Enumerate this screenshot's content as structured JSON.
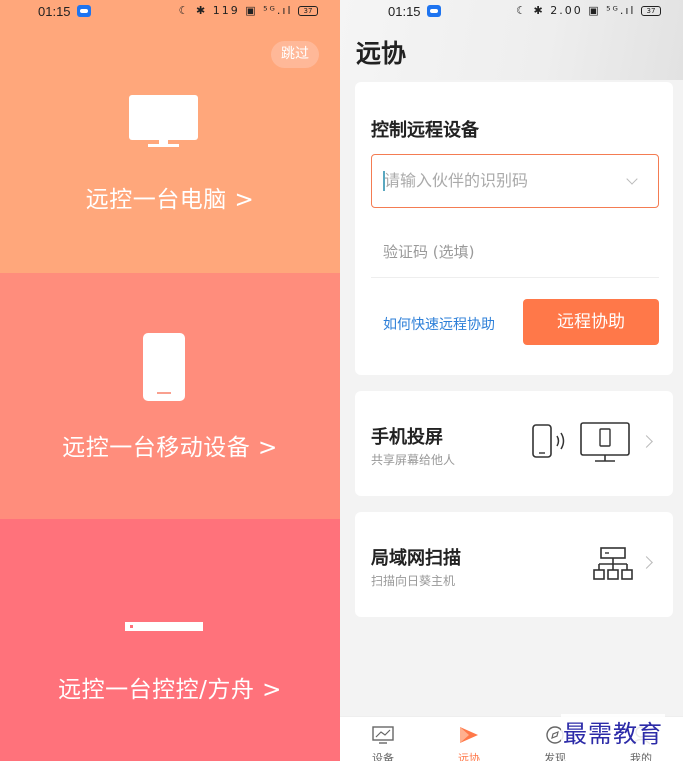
{
  "left": {
    "status": {
      "time": "01:15",
      "icons": "☾ ✱ 119 ▣ ⁵ᴳ.ıl",
      "battery": "37"
    },
    "skip_label": "跳过",
    "options": [
      {
        "label": "远控一台电脑 >",
        "icon": "monitor-icon"
      },
      {
        "label": "远控一台移动设备 >",
        "icon": "phone-icon"
      },
      {
        "label": "远控一台控控/方舟 >",
        "icon": "box-device-icon"
      }
    ],
    "colors": {
      "panel1": "#FFA77B",
      "panel2": "#FF8D7C",
      "panel3": "#FF727B"
    }
  },
  "right": {
    "status": {
      "time": "01:15",
      "icons": "☾ ✱ 2.00 ▣ ⁵ᴳ.ıl",
      "battery": "37"
    },
    "title": "远协",
    "control": {
      "title": "控制远程设备",
      "partner_placeholder": "请输入伙伴的识别码",
      "verify_placeholder": "验证码 (选填)",
      "help_link": "如何快速远程协助",
      "assist_button": "远程协助"
    },
    "features": [
      {
        "title": "手机投屏",
        "subtitle": "共享屏幕给他人",
        "icon": "cast-screen-icon"
      },
      {
        "title": "局域网扫描",
        "subtitle": "扫描向日葵主机",
        "icon": "network-scan-icon"
      }
    ],
    "tabs": [
      {
        "label": "设备",
        "icon": "device-icon",
        "active": false
      },
      {
        "label": "远协",
        "icon": "remote-assist-icon",
        "active": true
      },
      {
        "label": "发现",
        "icon": "discover-icon",
        "active": false
      },
      {
        "label": "我的",
        "icon": "profile-icon",
        "active": false
      }
    ],
    "watermark": "最需教育",
    "accent": "#FF7849",
    "link_color": "#2D7FD8"
  }
}
